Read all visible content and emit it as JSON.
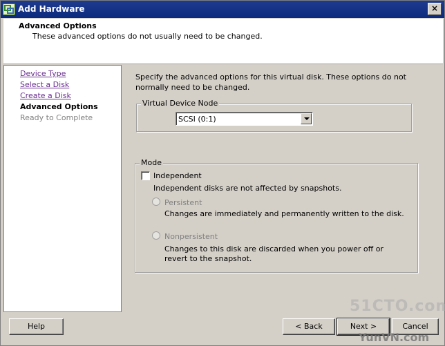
{
  "window": {
    "title": "Add Hardware"
  },
  "header": {
    "title": "Advanced Options",
    "subtitle": "These advanced options do not usually need to be changed."
  },
  "sidebar": {
    "items": [
      {
        "label": "Device Type",
        "state": "link"
      },
      {
        "label": "Select a Disk",
        "state": "link"
      },
      {
        "label": "Create a Disk",
        "state": "link"
      },
      {
        "label": "Advanced Options",
        "state": "current"
      },
      {
        "label": "Ready to Complete",
        "state": "disabled"
      }
    ]
  },
  "main": {
    "intro": "Specify the advanced options for this virtual disk. These options do not normally need to be changed.",
    "virtual_device_node": {
      "legend": "Virtual Device Node",
      "selected": "SCSI (0:1)"
    },
    "mode": {
      "legend": "Mode",
      "independent_label": "Independent",
      "independent_checked": false,
      "independent_desc": "Independent disks are not affected by snapshots.",
      "persistent_label": "Persistent",
      "persistent_desc": "Changes are immediately and permanently written to the disk.",
      "nonpersistent_label": "Nonpersistent",
      "nonpersistent_desc": "Changes to this disk are discarded when you power off or revert to the snapshot."
    }
  },
  "footer": {
    "help": "Help",
    "back": "< Back",
    "next": "Next >",
    "cancel": "Cancel"
  },
  "watermark": {
    "line1": "51CTO.com",
    "line2": "YunVN.com"
  },
  "colors": {
    "titlebar": "#0b2a7e",
    "link": "#6a2f8f",
    "disabled": "#808080"
  }
}
